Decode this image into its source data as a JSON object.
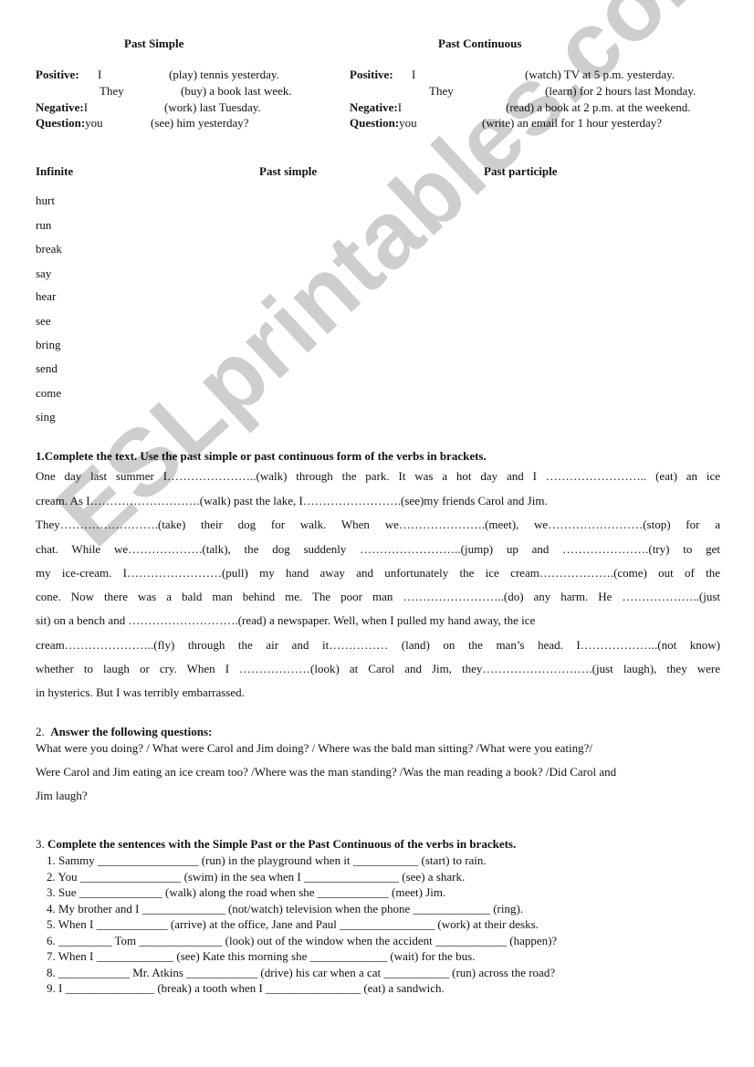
{
  "watermark": "ESLprintables.com",
  "grammar": {
    "past_simple": {
      "title": "Past Simple",
      "positive_label": "Positive:",
      "positive_1": {
        "subject": "I",
        "rest": "(play) tennis yesterday."
      },
      "positive_2": {
        "subject": "They",
        "rest": "(buy) a book last week."
      },
      "negative_label": "Negative:",
      "negative": {
        "subject": "I",
        "rest": "(work) last Tuesday."
      },
      "question_label": "Question:",
      "question": {
        "subject": "you",
        "rest": "(see) him yesterday?"
      }
    },
    "past_continuous": {
      "title": "Past Continuous",
      "positive_label": "Positive:",
      "positive_1": {
        "subject": "I",
        "rest": "(watch) TV at 5 p.m. yesterday."
      },
      "positive_2": {
        "subject": "They",
        "rest": "(learn) for 2 hours last Monday."
      },
      "negative_label": "Negative:",
      "negative": {
        "subject": "I",
        "rest": "(read) a book at 2 p.m. at the weekend."
      },
      "question_label": "Question:",
      "question": {
        "subject": "you",
        "rest": "(write) an email for 1 hour yesterday?"
      }
    }
  },
  "verb_table": {
    "headers": [
      "Infinite",
      "Past simple",
      "Past participle"
    ],
    "verbs": [
      "hurt",
      "run",
      "break",
      "say",
      "hear",
      "see",
      "bring",
      "send",
      "come",
      "sing"
    ]
  },
  "exercise1": {
    "heading": "1.Complete the text. Use the past simple or past continuous form of the verbs in brackets.",
    "lines": [
      "One day last summer I…………………..(walk) through the park. It was a hot day and I …………………….. (eat) an ice",
      "cream. As I……………………….(walk) past the lake, I…………………….(see)my friends Carol and Jim.",
      "They…………………….(take) their dog for  walk. When we………………….(meet), we……………………(stop)  for  a",
      "chat. While we……………….(talk), the dog suddenly ……………………..(jump) up and ………………….(try) to get",
      "my ice-cream.  I……………………(pull) my hand away and unfortunately the ice cream……………….(come) out of the",
      "cone. Now there was a bald man behind me. The poor man ……………………..(do) any harm. He ………………..(just",
      "sit) on a bench and ……………………….(read) a newspaper. Well, when I pulled my hand away, the ice",
      "cream…………………..(fly) through the air and it…………… (land) on the man’s head.  I………………..(not know)",
      "whether to laugh or cry. When I ………………(look) at Carol and Jim, they……………………….(just laugh), they were",
      "in hysterics. But I was terribly embarrassed."
    ]
  },
  "exercise2": {
    "number": "2.",
    "heading": "Answer the following questions:",
    "lines": [
      "What were you doing? / What were Carol and Jim doing? / Where was the bald man sitting? /What were you eating?/",
      "Were Carol and Jim eating an ice cream too? /Where was the man standing? /Was the man reading a book? /Did Carol and",
      "Jim laugh?"
    ]
  },
  "exercise3": {
    "number": "3.",
    "heading": "Complete the sentences with the Simple Past or the Past Continuous of the verbs in brackets.",
    "sentences": [
      "1.  Sammy _________________ (run) in the playground when it ___________ (start) to rain.",
      "2. You _________________ (swim) in the sea when I ________________ (see) a shark.",
      "3. Sue ______________ (walk) along the road when she ____________ (meet) Jim.",
      "4. My brother and I ______________ (not/watch) television when the phone _____________ (ring).",
      "5. When I ____________ (arrive) at the office, Jane and Paul ________________ (work) at their desks.",
      "6.  _________ Tom ______________ (look) out of the window when the accident ____________ (happen)?",
      "7. When I _____________ (see) Kate this morning she _____________ (wait) for the bus.",
      "8. ____________ Mr. Atkins ____________ (drive) his car when a cat ___________ (run) across the road?",
      "9. I _______________ (break) a tooth when I ________________ (eat) a sandwich."
    ]
  }
}
